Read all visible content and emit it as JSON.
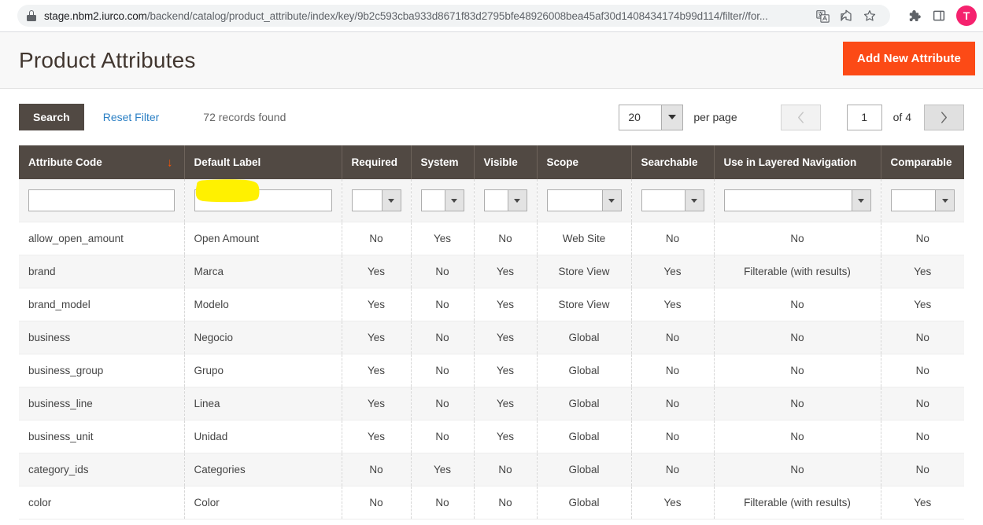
{
  "browser": {
    "url_prefix": "stage.nbm2.iurco.com",
    "url_path": "/backend/catalog/product_attribute/index/key/9b2c593cba933d8671f83d2795bfe48926008bea45af30d1408434174b99d114/filter//for...",
    "lock_icon": "lock-icon",
    "translate_icon": "translate-icon",
    "share_icon": "share-icon",
    "bookmark_icon": "star-icon",
    "extensions_icon": "puzzle-icon",
    "sidepanel_icon": "side-panel-icon",
    "avatar_letter": "T"
  },
  "header": {
    "title": "Product Attributes",
    "add_button_label": "Add New Attribute",
    "accent_color": "#fc4a16"
  },
  "toolbar": {
    "search_label": "Search",
    "reset_filter_label": "Reset Filter",
    "records_found": "72 records found",
    "per_page_value": "20",
    "per_page_label": "per page",
    "prev_icon": "chevron-left-icon",
    "next_icon": "chevron-right-icon",
    "current_page": "1",
    "of_label": "of 4"
  },
  "grid": {
    "columns": [
      {
        "label": "Attribute Code",
        "align": "left",
        "sorted": true,
        "sort_icon": "arrow-down-icon"
      },
      {
        "label": "Default Label",
        "align": "left",
        "sorted": false
      },
      {
        "label": "Required",
        "align": "left",
        "sorted": false
      },
      {
        "label": "System",
        "align": "left",
        "sorted": false
      },
      {
        "label": "Visible",
        "align": "left",
        "sorted": false
      },
      {
        "label": "Scope",
        "align": "left",
        "sorted": false
      },
      {
        "label": "Searchable",
        "align": "left",
        "sorted": false
      },
      {
        "label": "Use in Layered Navigation",
        "align": "left",
        "sorted": false
      },
      {
        "label": "Comparable",
        "align": "left",
        "sorted": false
      }
    ],
    "filters": [
      {
        "type": "text",
        "value": "",
        "name": "filter-attribute-code"
      },
      {
        "type": "text",
        "value": "",
        "name": "filter-default-label",
        "highlighted": true
      },
      {
        "type": "select",
        "value": "",
        "name": "filter-required"
      },
      {
        "type": "select",
        "value": "",
        "name": "filter-system"
      },
      {
        "type": "select",
        "value": "",
        "name": "filter-visible"
      },
      {
        "type": "select",
        "value": "",
        "name": "filter-scope"
      },
      {
        "type": "select",
        "value": "",
        "name": "filter-searchable"
      },
      {
        "type": "select",
        "value": "",
        "name": "filter-layered-navigation"
      },
      {
        "type": "select",
        "value": "",
        "name": "filter-comparable"
      }
    ],
    "rows": [
      {
        "attribute_code": "allow_open_amount",
        "default_label": "Open Amount",
        "required": "No",
        "system": "Yes",
        "visible": "No",
        "scope": "Web Site",
        "searchable": "No",
        "layered_navigation": "No",
        "comparable": "No"
      },
      {
        "attribute_code": "brand",
        "default_label": "Marca",
        "required": "Yes",
        "system": "No",
        "visible": "Yes",
        "scope": "Store View",
        "searchable": "Yes",
        "layered_navigation": "Filterable (with results)",
        "comparable": "Yes"
      },
      {
        "attribute_code": "brand_model",
        "default_label": "Modelo",
        "required": "Yes",
        "system": "No",
        "visible": "Yes",
        "scope": "Store View",
        "searchable": "Yes",
        "layered_navigation": "No",
        "comparable": "Yes"
      },
      {
        "attribute_code": "business",
        "default_label": "Negocio",
        "required": "Yes",
        "system": "No",
        "visible": "Yes",
        "scope": "Global",
        "searchable": "No",
        "layered_navigation": "No",
        "comparable": "No"
      },
      {
        "attribute_code": "business_group",
        "default_label": "Grupo",
        "required": "Yes",
        "system": "No",
        "visible": "Yes",
        "scope": "Global",
        "searchable": "No",
        "layered_navigation": "No",
        "comparable": "No"
      },
      {
        "attribute_code": "business_line",
        "default_label": "Linea",
        "required": "Yes",
        "system": "No",
        "visible": "Yes",
        "scope": "Global",
        "searchable": "No",
        "layered_navigation": "No",
        "comparable": "No"
      },
      {
        "attribute_code": "business_unit",
        "default_label": "Unidad",
        "required": "Yes",
        "system": "No",
        "visible": "Yes",
        "scope": "Global",
        "searchable": "No",
        "layered_navigation": "No",
        "comparable": "No"
      },
      {
        "attribute_code": "category_ids",
        "default_label": "Categories",
        "required": "No",
        "system": "Yes",
        "visible": "No",
        "scope": "Global",
        "searchable": "No",
        "layered_navigation": "No",
        "comparable": "No"
      },
      {
        "attribute_code": "color",
        "default_label": "Color",
        "required": "No",
        "system": "No",
        "visible": "No",
        "scope": "Global",
        "searchable": "Yes",
        "layered_navigation": "Filterable (with results)",
        "comparable": "Yes"
      }
    ]
  },
  "annotation": {
    "type": "highlighter-mark",
    "color": "#fff000",
    "target": "filter-default-label"
  }
}
